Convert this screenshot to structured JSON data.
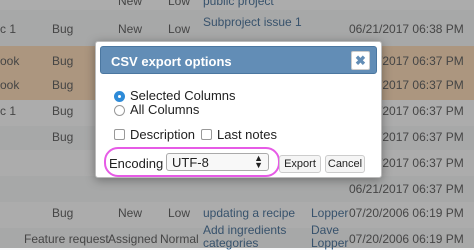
{
  "background_rows": [
    {
      "c0": "",
      "tracker": "",
      "status": "New",
      "priority": "Low",
      "subject": "public project",
      "assignee": "",
      "updated": ""
    },
    {
      "c0": "c 1",
      "tracker": "Bug",
      "status": "New",
      "priority": "Low",
      "subject": "Subproject issue 1",
      "assignee": "",
      "updated": "06/21/2017 06:38 PM"
    },
    {
      "c0": "ook",
      "tracker": "Bug",
      "status": "",
      "priority": "",
      "subject": "",
      "assignee": "",
      "updated": "06/21/2017 06:37 PM"
    },
    {
      "c0": "ook",
      "tracker": "Bug",
      "status": "",
      "priority": "",
      "subject": "",
      "assignee": "",
      "updated": "06/21/2017 06:37 PM"
    },
    {
      "c0": "c 1",
      "tracker": "Bug",
      "status": "",
      "priority": "",
      "subject": "",
      "assignee": "",
      "updated": "06/21/2017 06:37 PM"
    },
    {
      "c0": "",
      "tracker": "Bug",
      "status": "",
      "priority": "",
      "subject": "",
      "assignee": "",
      "updated": "06/21/2017 06:37 PM"
    },
    {
      "c0": "",
      "tracker": "",
      "status": "",
      "priority": "",
      "subject": "",
      "assignee": "",
      "updated": "06/21/2017 06:37 PM"
    },
    {
      "c0": "",
      "tracker": "",
      "status": "",
      "priority": "",
      "subject": "",
      "assignee": "",
      "updated": "06/21/2017 06:37 PM"
    },
    {
      "c0": "",
      "tracker": "Bug",
      "status": "New",
      "priority": "Low",
      "subject": "updating a recipe",
      "assignee": "Lopper",
      "updated": "07/20/2006 06:19 PM"
    },
    {
      "c0": "",
      "tracker": "Feature request",
      "status": "Assigned",
      "priority": "Normal",
      "subject": "Add ingredients categories",
      "assignee": "Dave Lopper",
      "updated": "07/20/2006 06:19 PM"
    }
  ],
  "dialog": {
    "title": "CSV export options",
    "close_glyph": "✖",
    "options": {
      "selected_columns": "Selected Columns",
      "all_columns": "All Columns",
      "description": "Description",
      "last_notes": "Last notes"
    },
    "selected_option": "selected_columns",
    "encoding_label": "Encoding",
    "encoding_value": "UTF-8",
    "export_button": "Export",
    "cancel_button": "Cancel"
  },
  "colors": {
    "header_bg": "#628db6",
    "highlight_row": "#ffd8ae",
    "radio_checked": "#2e8bd8",
    "annotation": "#e65be6"
  },
  "icons": {
    "close": "close-icon",
    "select_arrows": "select-arrows-icon"
  }
}
